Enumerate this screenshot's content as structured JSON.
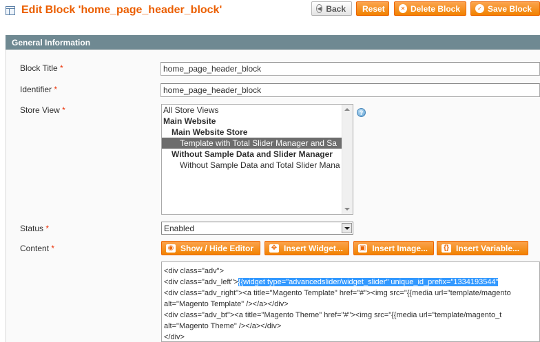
{
  "header": {
    "title": "Edit Block 'home_page_header_block'",
    "back_label": "Back",
    "reset_label": "Reset",
    "delete_label": "Delete Block",
    "save_label": "Save Block"
  },
  "section": {
    "title": "General Information"
  },
  "form": {
    "block_title": {
      "label": "Block Title",
      "required_mark": "*",
      "value": "home_page_header_block"
    },
    "identifier": {
      "label": "Identifier",
      "required_mark": "*",
      "value": "home_page_header_block"
    },
    "store_view": {
      "label": "Store View",
      "required_mark": "*",
      "options": [
        {
          "text": "All Store Views",
          "kind": "option",
          "level": 0
        },
        {
          "text": "Main Website",
          "kind": "group",
          "level": 0
        },
        {
          "text": "Main Website Store",
          "kind": "group",
          "level": 1
        },
        {
          "text": "Template with Total Slider Manager and Sa",
          "kind": "option",
          "level": 2,
          "selected": true
        },
        {
          "text": "Without Sample Data and Slider Manager",
          "kind": "group",
          "level": 1
        },
        {
          "text": "Without Sample Data and Total Slider Mana",
          "kind": "option",
          "level": 2
        }
      ]
    },
    "status": {
      "label": "Status",
      "required_mark": "*",
      "value": "Enabled"
    },
    "content": {
      "label": "Content",
      "required_mark": "*",
      "buttons": {
        "toggle_editor": "Show / Hide Editor",
        "insert_widget": "Insert Widget...",
        "insert_image": "Insert Image...",
        "insert_variable": "Insert Variable..."
      },
      "lines": {
        "l1": "<div class=\"adv\">",
        "l2_pre": "<div class=\"adv_left\">",
        "l2_sel": "{{widget type=\"advancedslider/widget_slider\" unique_id_prefix=\"1334193544\"",
        "l3": "<div class=\"adv_right\"><a title=\"Magento Template\" href=\"#\"><img src=\"{{media url=\"template/magento",
        "l4": "alt=\"Magento Template\" /></a></div>",
        "l5": "<div class=\"adv_bt\"><a title=\"Magento Theme\" href=\"#\"><img src=\"{{media url=\"template/magento_t",
        "l6": "alt=\"Magento Theme\" /></a></div>",
        "l7": "</div>"
      }
    }
  },
  "colors": {
    "accent": "#eb5e00",
    "button": "#f18200",
    "section_bar": "#6f8992",
    "selection": "#3399ff"
  },
  "icons": [
    "block-icon",
    "back-icon",
    "delete-icon",
    "save-icon",
    "help-icon",
    "eye-icon",
    "widget-icon",
    "image-icon",
    "variable-icon"
  ]
}
